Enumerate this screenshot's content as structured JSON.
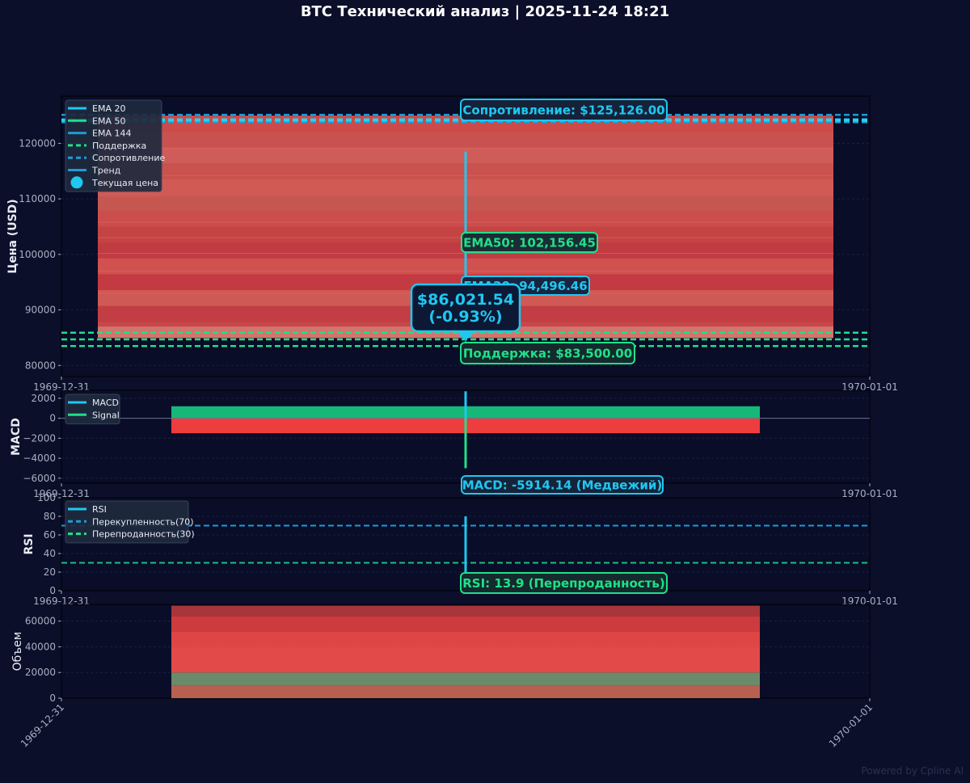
{
  "title": "BTC Технический анализ | 2025-11-24 18:21",
  "watermark": "Powered by Cpline AI",
  "colors": {
    "background": "#0b0f2a",
    "panel": "#090d28",
    "cyan": "#1ec8f0",
    "blue": "#1e9bd8",
    "green": "#1fe08a",
    "red": "#e84848",
    "text": "#a8b0c0",
    "grid": "#1a2040"
  },
  "chart_data": [
    {
      "type": "line",
      "panel": "price",
      "ylabel": "Цена (USD)",
      "ylim": [
        78000,
        128500
      ],
      "yticks": [
        80000,
        90000,
        100000,
        110000,
        120000
      ],
      "ytick_labels": [
        "80000",
        "90000",
        "100000",
        "110000",
        "120000"
      ],
      "xtick_labels": [
        "1969-12-31",
        "1970-01-01"
      ],
      "legend": {
        "position": "top-left",
        "entries": [
          {
            "label": "EMA 20",
            "style": "solid",
            "color": "#1ec8f0"
          },
          {
            "label": "EMA 50",
            "style": "solid",
            "color": "#1fe08a"
          },
          {
            "label": "EMA 144",
            "style": "solid",
            "color": "#1e9bd8"
          },
          {
            "label": "Поддержка",
            "style": "dashed",
            "color": "#1fe08a"
          },
          {
            "label": "Сопротивление",
            "style": "dashed",
            "color": "#1e9bd8"
          },
          {
            "label": "Тренд",
            "style": "solid",
            "color": "#1e9bd8"
          },
          {
            "label": "Текущая цена",
            "style": "dot",
            "color": "#1ec8f0"
          }
        ]
      },
      "candle_range": [
        85000,
        125000
      ],
      "support_levels": [
        83500,
        84700,
        85900
      ],
      "resistance_levels": [
        123800,
        124200,
        125126
      ],
      "ema20": {
        "start": 118500,
        "end": 94496.46
      },
      "ema50": {
        "start": 108000,
        "end": 102156.45
      },
      "current_price": 86021.54,
      "annotations": {
        "resistance": "Сопротивление: $125,126.00",
        "ema50": "EMA50: 102,156.45",
        "ema20": "EMA20: 94,496.46",
        "price": "$86,021.54",
        "change": "(-0.93%)",
        "support": "Поддержка: $83,500.00"
      }
    },
    {
      "type": "bar",
      "panel": "macd",
      "ylabel": "MACD",
      "ylim": [
        -6500,
        2800
      ],
      "yticks": [
        -6000,
        -4000,
        -2000,
        0,
        2000
      ],
      "ytick_labels": [
        "−6000",
        "−4000",
        "−2000",
        "0",
        "2000"
      ],
      "xtick_labels": [
        "1969-12-31",
        "1970-01-01"
      ],
      "legend": {
        "position": "top-left",
        "entries": [
          {
            "label": "MACD",
            "style": "solid",
            "color": "#1ec8f0"
          },
          {
            "label": "Signal",
            "style": "solid",
            "color": "#1fe08a"
          }
        ]
      },
      "hist_positive": 1200,
      "hist_negative": -1500,
      "macd": {
        "start": 2700,
        "end": -5914.14
      },
      "signal": {
        "start": 0,
        "end": -5000
      },
      "annotation": "MACD: -5914.14 (Медвежий)"
    },
    {
      "type": "line",
      "panel": "rsi",
      "ylabel": "RSI",
      "ylim": [
        0,
        100
      ],
      "yticks": [
        0,
        20,
        40,
        60,
        80,
        100
      ],
      "ytick_labels": [
        "0",
        "20",
        "40",
        "60",
        "80",
        "100"
      ],
      "xtick_labels": [
        "1969-12-31",
        "1970-01-01"
      ],
      "legend": {
        "position": "top-left",
        "entries": [
          {
            "label": "RSI",
            "style": "solid",
            "color": "#1ec8f0"
          },
          {
            "label": "Перекупленность(70)",
            "style": "dashed",
            "color": "#1e9bd8"
          },
          {
            "label": "Перепроданность(30)",
            "style": "dashed",
            "color": "#1fe08a"
          }
        ]
      },
      "overbought": 70,
      "oversold": 30,
      "rsi": {
        "start": 80,
        "end": 13.9
      },
      "annotation": "RSI: 13.9 (Перепроданность)"
    },
    {
      "type": "bar",
      "panel": "volume",
      "ylabel": "Объем",
      "ylim": [
        0,
        73000
      ],
      "yticks": [
        0,
        20000,
        40000,
        60000
      ],
      "ytick_labels": [
        "0",
        "20000",
        "40000",
        "60000"
      ],
      "xtick_labels": [
        "1969-12-31",
        "1970-01-01"
      ],
      "bands": [
        {
          "from": 0,
          "to": 10000,
          "color": "#b86050"
        },
        {
          "from": 10000,
          "to": 20000,
          "color": "#6a8a6a"
        },
        {
          "from": 20000,
          "to": 40000,
          "color": "#e24a4a"
        },
        {
          "from": 40000,
          "to": 52000,
          "color": "#e04545"
        },
        {
          "from": 52000,
          "to": 64000,
          "color": "#cc3b3e"
        },
        {
          "from": 64000,
          "to": 72000,
          "color": "#a8353a"
        }
      ]
    }
  ]
}
